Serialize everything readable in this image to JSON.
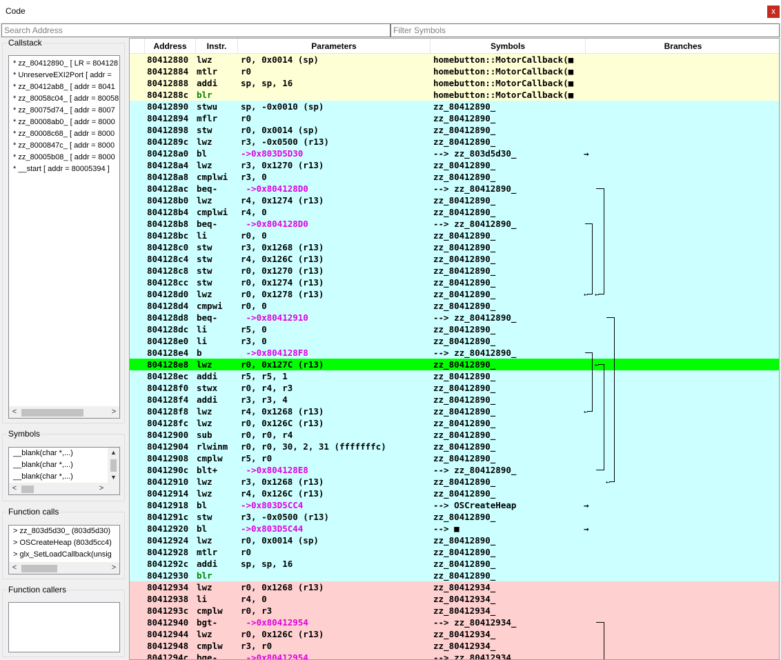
{
  "window": {
    "title": "Code",
    "close_label": "x"
  },
  "search": {
    "address_placeholder": "Search Address",
    "symbols_placeholder": "Filter Symbols"
  },
  "callstack": {
    "title": "Callstack",
    "items": [
      "* zz_80412890_ [ LR = 804128",
      "* UnreserveEXI2Port [ addr =",
      "* zz_80412ab8_ [ addr = 8041",
      "* zz_80058c04_ [ addr = 80058",
      "* zz_80075d74_ [ addr = 8007",
      "* zz_80008ab0_ [ addr = 8000",
      "* zz_80008c68_ [ addr = 8000",
      "* zz_8000847c_ [ addr = 8000",
      "* zz_80005b08_ [ addr = 8000",
      "* __start [ addr = 80005394 ]"
    ]
  },
  "symbols": {
    "title": "Symbols",
    "items": [
      "__blank(char *,...)",
      "__blank(char *,...)",
      "__blank(char *,...)"
    ]
  },
  "function_calls": {
    "title": "Function calls",
    "items": [
      "> zz_803d5d30_ (803d5d30)",
      "> OSCreateHeap (803d5cc4)",
      "> glx_SetLoadCallback(unsig"
    ]
  },
  "function_callers": {
    "title": "Function callers",
    "items": []
  },
  "code_table": {
    "headers": [
      "Address",
      "Instr.",
      "Parameters",
      "Symbols",
      "Branches"
    ],
    "rows": [
      {
        "addr": "80412880",
        "ins": "lwz",
        "params": "r0, 0x0014 (sp)",
        "sym": "homebutton::MotorCallback(■",
        "bg": "yellow"
      },
      {
        "addr": "80412884",
        "ins": "mtlr",
        "params": "r0",
        "sym": "homebutton::MotorCallback(■",
        "bg": "yellow"
      },
      {
        "addr": "80412888",
        "ins": "addi",
        "params": "sp, sp, 16",
        "sym": "homebutton::MotorCallback(■",
        "bg": "yellow"
      },
      {
        "addr": "8041288c",
        "ins": "blr",
        "params": "",
        "sym": "homebutton::MotorCallback(■",
        "bg": "yellow",
        "ins_style": "blr"
      },
      {
        "addr": "80412890",
        "ins": "stwu",
        "params": "sp, -0x0010 (sp)",
        "sym": "zz_80412890_",
        "bg": "cyan"
      },
      {
        "addr": "80412894",
        "ins": "mflr",
        "params": "r0",
        "sym": "zz_80412890_",
        "bg": "cyan"
      },
      {
        "addr": "80412898",
        "ins": "stw",
        "params": "r0, 0x0014 (sp)",
        "sym": "zz_80412890_",
        "bg": "cyan"
      },
      {
        "addr": "8041289c",
        "ins": "lwz",
        "params": "r3, -0x0500 (r13)",
        "sym": "zz_80412890_",
        "bg": "cyan"
      },
      {
        "addr": "804128a0",
        "ins": "bl",
        "params": "->0x803D5D30",
        "sym": "--> zz_803d5d30_",
        "bg": "cyan",
        "target": true,
        "arrow": "→"
      },
      {
        "addr": "804128a4",
        "ins": "lwz",
        "params": "r3, 0x1270 (r13)",
        "sym": "zz_80412890_",
        "bg": "cyan"
      },
      {
        "addr": "804128a8",
        "ins": "cmplwi",
        "params": "r3, 0",
        "sym": "zz_80412890_",
        "bg": "cyan"
      },
      {
        "addr": "804128ac",
        "ins": "beq-",
        "params": " ->0x804128D0",
        "sym": "--> zz_80412890_",
        "bg": "cyan",
        "target": true
      },
      {
        "addr": "804128b0",
        "ins": "lwz",
        "params": "r4, 0x1274 (r13)",
        "sym": "zz_80412890_",
        "bg": "cyan"
      },
      {
        "addr": "804128b4",
        "ins": "cmplwi",
        "params": "r4, 0",
        "sym": "zz_80412890_",
        "bg": "cyan"
      },
      {
        "addr": "804128b8",
        "ins": "beq-",
        "params": " ->0x804128D0",
        "sym": "--> zz_80412890_",
        "bg": "cyan",
        "target": true
      },
      {
        "addr": "804128bc",
        "ins": "li",
        "params": "r0, 0",
        "sym": "zz_80412890_",
        "bg": "cyan"
      },
      {
        "addr": "804128c0",
        "ins": "stw",
        "params": "r3, 0x1268 (r13)",
        "sym": "zz_80412890_",
        "bg": "cyan"
      },
      {
        "addr": "804128c4",
        "ins": "stw",
        "params": "r4, 0x126C (r13)",
        "sym": "zz_80412890_",
        "bg": "cyan"
      },
      {
        "addr": "804128c8",
        "ins": "stw",
        "params": "r0, 0x1270 (r13)",
        "sym": "zz_80412890_",
        "bg": "cyan"
      },
      {
        "addr": "804128cc",
        "ins": "stw",
        "params": "r0, 0x1274 (r13)",
        "sym": "zz_80412890_",
        "bg": "cyan"
      },
      {
        "addr": "804128d0",
        "ins": "lwz",
        "params": "r0, 0x1278 (r13)",
        "sym": "zz_80412890_",
        "bg": "cyan"
      },
      {
        "addr": "804128d4",
        "ins": "cmpwi",
        "params": "r0, 0",
        "sym": "zz_80412890_",
        "bg": "cyan"
      },
      {
        "addr": "804128d8",
        "ins": "beq-",
        "params": " ->0x80412910",
        "sym": "--> zz_80412890_",
        "bg": "cyan",
        "target": true
      },
      {
        "addr": "804128dc",
        "ins": "li",
        "params": "r5, 0",
        "sym": "zz_80412890_",
        "bg": "cyan"
      },
      {
        "addr": "804128e0",
        "ins": "li",
        "params": "r3, 0",
        "sym": "zz_80412890_",
        "bg": "cyan"
      },
      {
        "addr": "804128e4",
        "ins": "b",
        "params": " ->0x804128F8",
        "sym": "--> zz_80412890_",
        "bg": "cyan",
        "target": true
      },
      {
        "addr": "804128e8",
        "ins": "lwz",
        "params": "r0, 0x127C (r13)",
        "sym": "zz_80412890_",
        "bg": "green"
      },
      {
        "addr": "804128ec",
        "ins": "addi",
        "params": "r5, r5, 1",
        "sym": "zz_80412890_",
        "bg": "cyan"
      },
      {
        "addr": "804128f0",
        "ins": "stwx",
        "params": "r0, r4, r3",
        "sym": "zz_80412890_",
        "bg": "cyan"
      },
      {
        "addr": "804128f4",
        "ins": "addi",
        "params": "r3, r3, 4",
        "sym": "zz_80412890_",
        "bg": "cyan"
      },
      {
        "addr": "804128f8",
        "ins": "lwz",
        "params": "r4, 0x1268 (r13)",
        "sym": "zz_80412890_",
        "bg": "cyan"
      },
      {
        "addr": "804128fc",
        "ins": "lwz",
        "params": "r0, 0x126C (r13)",
        "sym": "zz_80412890_",
        "bg": "cyan"
      },
      {
        "addr": "80412900",
        "ins": "sub",
        "params": "r0, r0, r4",
        "sym": "zz_80412890_",
        "bg": "cyan"
      },
      {
        "addr": "80412904",
        "ins": "rlwinm",
        "params": "r0, r0, 30, 2, 31 (fffffffc)",
        "sym": "zz_80412890_",
        "bg": "cyan"
      },
      {
        "addr": "80412908",
        "ins": "cmplw",
        "params": "r5, r0",
        "sym": "zz_80412890_",
        "bg": "cyan"
      },
      {
        "addr": "8041290c",
        "ins": "blt+",
        "params": " ->0x804128E8",
        "sym": "--> zz_80412890_",
        "bg": "cyan",
        "target": true
      },
      {
        "addr": "80412910",
        "ins": "lwz",
        "params": "r3, 0x1268 (r13)",
        "sym": "zz_80412890_",
        "bg": "cyan"
      },
      {
        "addr": "80412914",
        "ins": "lwz",
        "params": "r4, 0x126C (r13)",
        "sym": "zz_80412890_",
        "bg": "cyan"
      },
      {
        "addr": "80412918",
        "ins": "bl",
        "params": "->0x803D5CC4",
        "sym": "--> OSCreateHeap",
        "bg": "cyan",
        "target": true,
        "arrow": "→"
      },
      {
        "addr": "8041291c",
        "ins": "stw",
        "params": "r3, -0x0500 (r13)",
        "sym": "zz_80412890_",
        "bg": "cyan"
      },
      {
        "addr": "80412920",
        "ins": "bl",
        "params": "->0x803D5C44",
        "sym": "--> ■",
        "bg": "cyan",
        "target": true,
        "arrow": "→"
      },
      {
        "addr": "80412924",
        "ins": "lwz",
        "params": "r0, 0x0014 (sp)",
        "sym": "zz_80412890_",
        "bg": "cyan"
      },
      {
        "addr": "80412928",
        "ins": "mtlr",
        "params": "r0",
        "sym": "zz_80412890_",
        "bg": "cyan"
      },
      {
        "addr": "8041292c",
        "ins": "addi",
        "params": "sp, sp, 16",
        "sym": "zz_80412890_",
        "bg": "cyan"
      },
      {
        "addr": "80412930",
        "ins": "blr",
        "params": "",
        "sym": "zz_80412890_",
        "bg": "cyan",
        "ins_style": "blr"
      },
      {
        "addr": "80412934",
        "ins": "lwz",
        "params": "r0, 0x1268 (r13)",
        "sym": "zz_80412934_",
        "bg": "pink"
      },
      {
        "addr": "80412938",
        "ins": "li",
        "params": "r4, 0",
        "sym": "zz_80412934_",
        "bg": "pink"
      },
      {
        "addr": "8041293c",
        "ins": "cmplw",
        "params": "r0, r3",
        "sym": "zz_80412934_",
        "bg": "pink"
      },
      {
        "addr": "80412940",
        "ins": "bgt-",
        "params": " ->0x80412954",
        "sym": "--> zz_80412934_",
        "bg": "pink",
        "target": true
      },
      {
        "addr": "80412944",
        "ins": "lwz",
        "params": "r0, 0x126C (r13)",
        "sym": "zz_80412934_",
        "bg": "pink"
      },
      {
        "addr": "80412948",
        "ins": "cmplw",
        "params": "r3, r0",
        "sym": "zz_80412934_",
        "bg": "pink"
      },
      {
        "addr": "8041294c",
        "ins": "bge-",
        "params": " ->0x80412954",
        "sym": "--> zz_80412934_",
        "bg": "pink",
        "target": true
      }
    ]
  }
}
